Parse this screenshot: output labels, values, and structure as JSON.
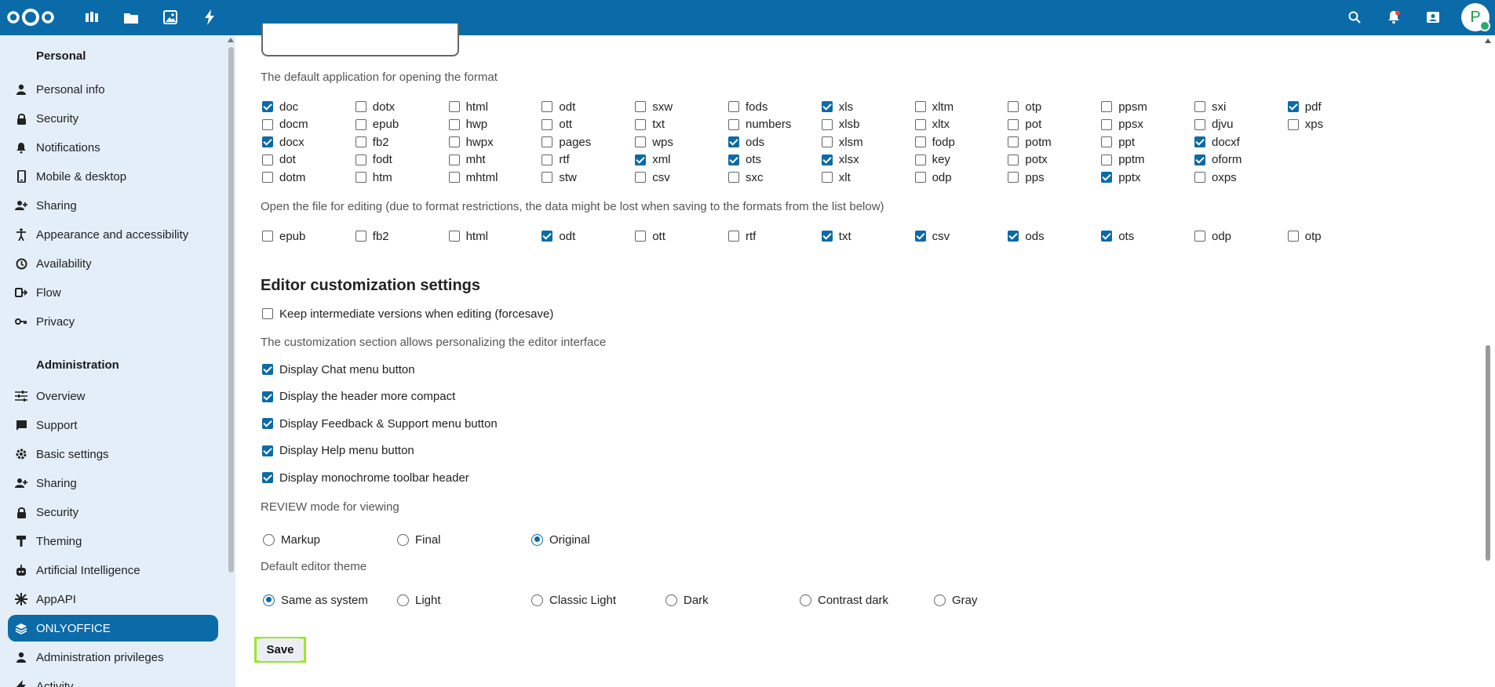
{
  "topbar": {
    "left_icons": [
      "dashboard-icon",
      "files-icon",
      "photos-icon",
      "activity-icon"
    ],
    "right_icons": [
      "search-icon",
      "notifications-icon",
      "contacts-icon"
    ],
    "avatar_initial": "P",
    "colors": {
      "bar": "#0b6aa8",
      "status": "#2fa96a"
    }
  },
  "sidebar": {
    "personal_heading": "Personal",
    "personal_items": [
      {
        "label": "Personal info",
        "icon": "person-icon"
      },
      {
        "label": "Security",
        "icon": "lock-icon"
      },
      {
        "label": "Notifications",
        "icon": "bell-icon"
      },
      {
        "label": "Mobile & desktop",
        "icon": "phone-icon"
      },
      {
        "label": "Sharing",
        "icon": "share-icon"
      },
      {
        "label": "Appearance and accessibility",
        "icon": "accessibility-icon"
      },
      {
        "label": "Availability",
        "icon": "clock-icon"
      },
      {
        "label": "Flow",
        "icon": "flow-icon"
      },
      {
        "label": "Privacy",
        "icon": "key-icon"
      }
    ],
    "admin_heading": "Administration",
    "admin_items": [
      {
        "label": "Overview",
        "icon": "tune-icon"
      },
      {
        "label": "Support",
        "icon": "chat-icon"
      },
      {
        "label": "Basic settings",
        "icon": "gear-icon"
      },
      {
        "label": "Sharing",
        "icon": "share-icon"
      },
      {
        "label": "Security",
        "icon": "lock-icon"
      },
      {
        "label": "Theming",
        "icon": "paint-icon"
      },
      {
        "label": "Artificial Intelligence",
        "icon": "robot-icon"
      },
      {
        "label": "AppAPI",
        "icon": "api-icon"
      },
      {
        "label": "ONLYOFFICE",
        "icon": "onlyoffice-icon",
        "active": true
      },
      {
        "label": "Administration privileges",
        "icon": "person-icon"
      },
      {
        "label": "Activity",
        "icon": "activity-icon"
      }
    ]
  },
  "main": {
    "default_app_label": "The default application for opening the format",
    "default_formats_columns": [
      [
        {
          "t": "doc",
          "c": true
        },
        {
          "t": "docm",
          "c": false
        },
        {
          "t": "docx",
          "c": true
        },
        {
          "t": "dot",
          "c": false
        },
        {
          "t": "dotm",
          "c": false
        }
      ],
      [
        {
          "t": "dotx",
          "c": false
        },
        {
          "t": "epub",
          "c": false
        },
        {
          "t": "fb2",
          "c": false
        },
        {
          "t": "fodt",
          "c": false
        },
        {
          "t": "htm",
          "c": false
        }
      ],
      [
        {
          "t": "html",
          "c": false
        },
        {
          "t": "hwp",
          "c": false
        },
        {
          "t": "hwpx",
          "c": false
        },
        {
          "t": "mht",
          "c": false
        },
        {
          "t": "mhtml",
          "c": false
        }
      ],
      [
        {
          "t": "odt",
          "c": false
        },
        {
          "t": "ott",
          "c": false
        },
        {
          "t": "pages",
          "c": false
        },
        {
          "t": "rtf",
          "c": false
        },
        {
          "t": "stw",
          "c": false
        }
      ],
      [
        {
          "t": "sxw",
          "c": false
        },
        {
          "t": "txt",
          "c": false
        },
        {
          "t": "wps",
          "c": false
        },
        {
          "t": "xml",
          "c": true
        },
        {
          "t": "csv",
          "c": false
        }
      ],
      [
        {
          "t": "fods",
          "c": false
        },
        {
          "t": "numbers",
          "c": false
        },
        {
          "t": "ods",
          "c": true
        },
        {
          "t": "ots",
          "c": true
        },
        {
          "t": "sxc",
          "c": false
        }
      ],
      [
        {
          "t": "xls",
          "c": true
        },
        {
          "t": "xlsb",
          "c": false
        },
        {
          "t": "xlsm",
          "c": false
        },
        {
          "t": "xlsx",
          "c": true
        },
        {
          "t": "xlt",
          "c": false
        }
      ],
      [
        {
          "t": "xltm",
          "c": false
        },
        {
          "t": "xltx",
          "c": false
        },
        {
          "t": "fodp",
          "c": false
        },
        {
          "t": "key",
          "c": false
        },
        {
          "t": "odp",
          "c": false
        }
      ],
      [
        {
          "t": "otp",
          "c": false
        },
        {
          "t": "pot",
          "c": false
        },
        {
          "t": "potm",
          "c": false
        },
        {
          "t": "potx",
          "c": false
        },
        {
          "t": "pps",
          "c": false
        }
      ],
      [
        {
          "t": "ppsm",
          "c": false
        },
        {
          "t": "ppsx",
          "c": false
        },
        {
          "t": "ppt",
          "c": false
        },
        {
          "t": "pptm",
          "c": false
        },
        {
          "t": "pptx",
          "c": true
        }
      ],
      [
        {
          "t": "sxi",
          "c": false
        },
        {
          "t": "djvu",
          "c": false
        },
        {
          "t": "docxf",
          "c": true
        },
        {
          "t": "oform",
          "c": true
        },
        {
          "t": "oxps",
          "c": false
        }
      ],
      [
        {
          "t": "pdf",
          "c": true
        },
        {
          "t": "xps",
          "c": false
        }
      ]
    ],
    "edit_label": "Open the file for editing (due to format restrictions, the data might be lost when saving to the formats from the list below)",
    "edit_formats": [
      {
        "t": "epub",
        "c": false
      },
      {
        "t": "fb2",
        "c": false
      },
      {
        "t": "html",
        "c": false
      },
      {
        "t": "odt",
        "c": true
      },
      {
        "t": "ott",
        "c": false
      },
      {
        "t": "rtf",
        "c": false
      },
      {
        "t": "txt",
        "c": true
      },
      {
        "t": "csv",
        "c": true
      },
      {
        "t": "ods",
        "c": true
      },
      {
        "t": "ots",
        "c": true
      },
      {
        "t": "odp",
        "c": false
      },
      {
        "t": "otp",
        "c": false
      }
    ],
    "editor_heading": "Editor customization settings",
    "forcesave_label": "Keep intermediate versions when editing (forcesave)",
    "forcesave_checked": false,
    "customization_label": "The customization section allows personalizing the editor interface",
    "customization_options": [
      {
        "t": "Display Chat menu button",
        "c": true
      },
      {
        "t": "Display the header more compact",
        "c": true
      },
      {
        "t": "Display Feedback & Support menu button",
        "c": true
      },
      {
        "t": "Display Help menu button",
        "c": true
      },
      {
        "t": "Display monochrome toolbar header",
        "c": true
      }
    ],
    "review_label": "REVIEW mode for viewing",
    "review_options": [
      {
        "t": "Markup",
        "c": false
      },
      {
        "t": "Final",
        "c": false
      },
      {
        "t": "Original",
        "c": true
      }
    ],
    "theme_label": "Default editor theme",
    "theme_options": [
      {
        "t": "Same as system",
        "c": true
      },
      {
        "t": "Light",
        "c": false
      },
      {
        "t": "Classic Light",
        "c": false
      },
      {
        "t": "Dark",
        "c": false
      },
      {
        "t": "Contrast dark",
        "c": false
      },
      {
        "t": "Gray",
        "c": false
      }
    ],
    "save_label": "Save"
  }
}
